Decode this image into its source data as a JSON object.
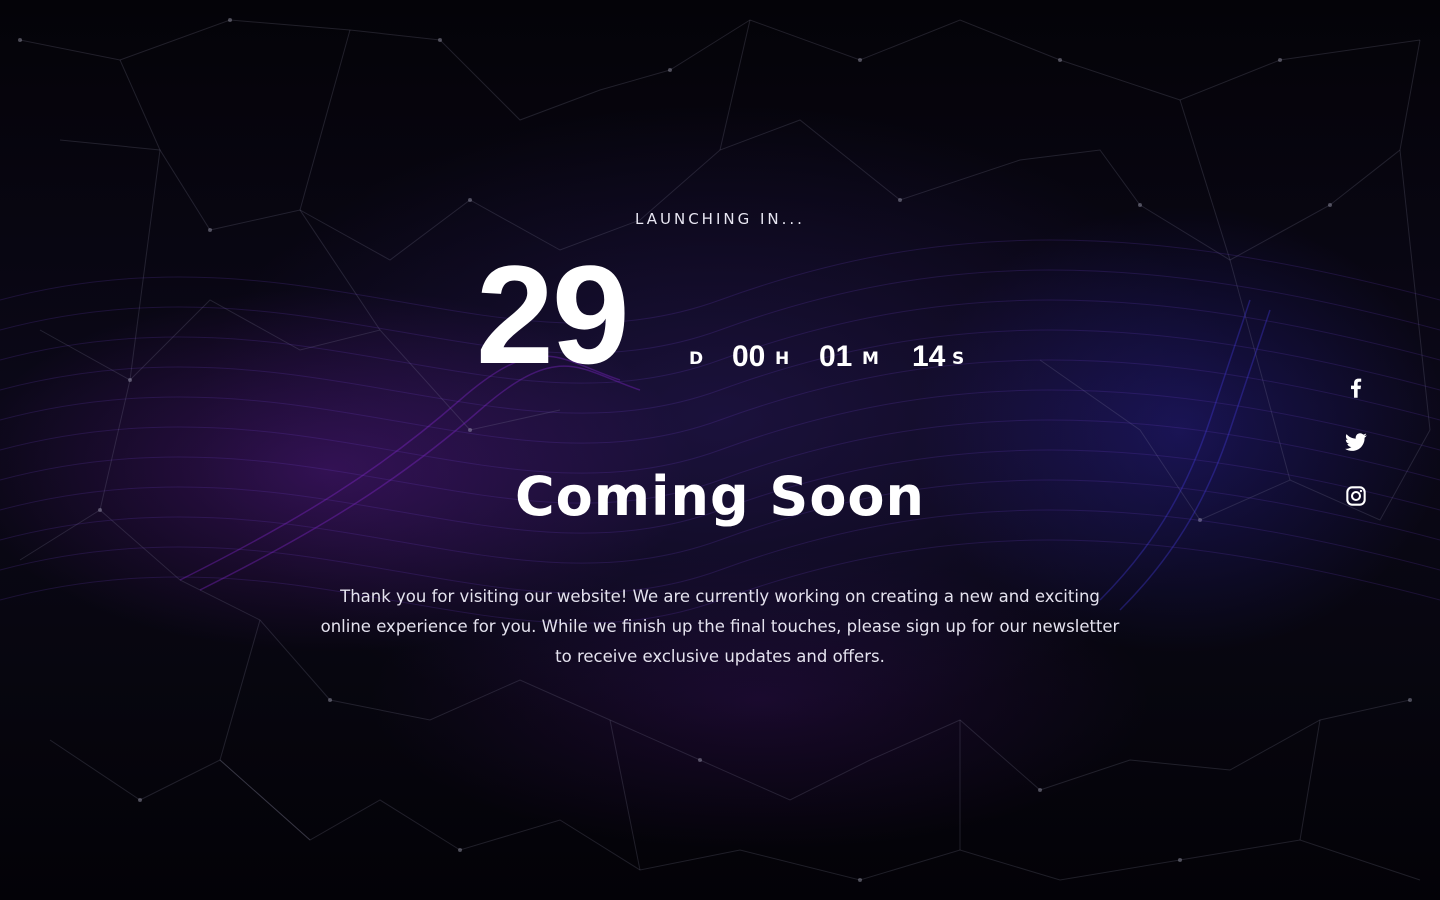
{
  "hero": {
    "eyebrow": "LAUNCHING IN...",
    "title": "Coming Soon",
    "description": "Thank you for visiting our website! We are currently working on creating a new and exciting online experience for you. While we finish up the final touches, please sign up for our newsletter to receive exclusive updates and offers."
  },
  "countdown": {
    "days": "29",
    "days_unit": "D",
    "hours": "00",
    "hours_unit": "H",
    "minutes": "01",
    "minutes_unit": "M",
    "seconds": "14",
    "seconds_unit": "S"
  },
  "social": [
    {
      "name": "facebook",
      "icon": "facebook-icon"
    },
    {
      "name": "twitter",
      "icon": "twitter-icon"
    },
    {
      "name": "instagram",
      "icon": "instagram-icon"
    }
  ],
  "colors": {
    "background": "#05040a",
    "accent_purple": "#6e1eaa",
    "accent_blue": "#3228be",
    "text": "#ffffff"
  }
}
